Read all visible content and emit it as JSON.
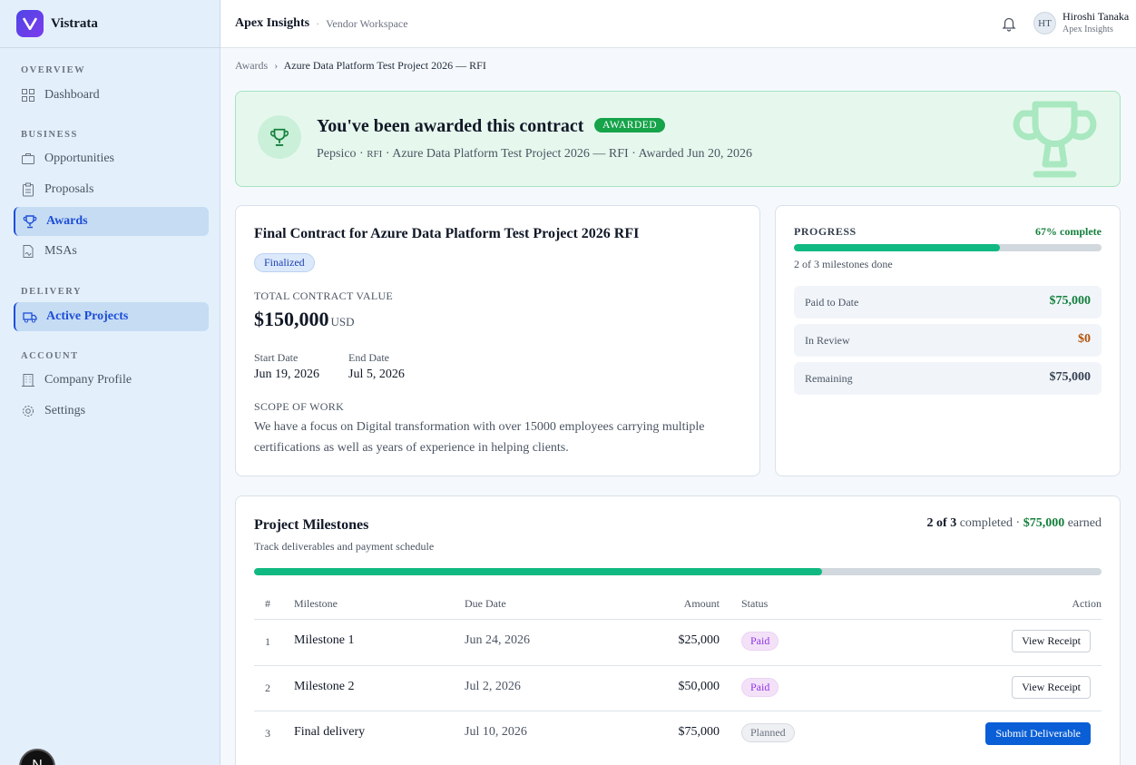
{
  "brand": {
    "name": "Vistrata"
  },
  "sidebar": {
    "sections": {
      "overview": "OVERVIEW",
      "business": "BUSINESS",
      "delivery": "DELIVERY",
      "account": "ACCOUNT"
    },
    "items": {
      "dashboard": "Dashboard",
      "opportunities": "Opportunities",
      "proposals": "Proposals",
      "awards": "Awards",
      "msas": "MSAs",
      "active_projects": "Active Projects",
      "company_profile": "Company Profile",
      "settings": "Settings"
    },
    "fab_letter": "N"
  },
  "topbar": {
    "org": "Apex Insights",
    "sep": "·",
    "workspace": "Vendor Workspace",
    "avatar_initials": "HT",
    "user_name": "Hiroshi Tanaka",
    "user_org": "Apex Insights"
  },
  "breadcrumb": {
    "parent": "Awards",
    "sep": "›",
    "current": "Azure Data Platform Test Project 2026 — RFI"
  },
  "award": {
    "title": "You've been awarded this contract",
    "badge": "AWARDED",
    "client": "Pepsico · ",
    "type": "RFI",
    "detail": " · Azure Data Platform Test Project 2026 — RFI · Awarded Jun 20, 2026"
  },
  "contract": {
    "title": "Final Contract for Azure Data Platform Test Project 2026 RFI",
    "status": "Finalized",
    "value_label": "TOTAL CONTRACT VALUE",
    "value": "$150,000",
    "currency": "USD",
    "start_label": "Start Date",
    "start_date": "Jun 19, 2026",
    "end_label": "End Date",
    "end_date": "Jul 5, 2026",
    "scope_label": "SCOPE OF WORK",
    "scope_text": "We have a focus on Digital transformation with over 15000 employees carrying multiple certifications as well as years of experience in helping clients."
  },
  "progress": {
    "label": "PROGRESS",
    "percent_text": "67% complete",
    "fraction": 0.67,
    "note": "2 of 3 milestones done",
    "stats": [
      {
        "label": "Paid to Date",
        "value": "$75,000",
        "color": "#15803d"
      },
      {
        "label": "In Review",
        "value": "$0",
        "color": "#b45309"
      },
      {
        "label": "Remaining",
        "value": "$75,000",
        "color": "#374151"
      }
    ]
  },
  "milestones": {
    "title": "Project Milestones",
    "subtitle": "Track deliverables and payment schedule",
    "summary_count": "2 of 3",
    "summary_completed": " completed · ",
    "summary_earned_value": "$75,000",
    "summary_earned": " earned",
    "fraction": 0.67,
    "columns": {
      "num": "#",
      "milestone": "Milestone",
      "due": "Due Date",
      "amount": "Amount",
      "status": "Status",
      "action": "Action"
    },
    "rows": [
      {
        "num": "1",
        "name": "Milestone 1",
        "due": "Jun 24, 2026",
        "amount": "$25,000",
        "status": "Paid",
        "action": "View Receipt"
      },
      {
        "num": "2",
        "name": "Milestone 2",
        "due": "Jul 2, 2026",
        "amount": "$50,000",
        "status": "Paid",
        "action": "View Receipt"
      },
      {
        "num": "3",
        "name": "Final delivery",
        "due": "Jul 10, 2026",
        "amount": "$75,000",
        "status": "Planned",
        "action": "Submit Deliverable"
      }
    ]
  }
}
